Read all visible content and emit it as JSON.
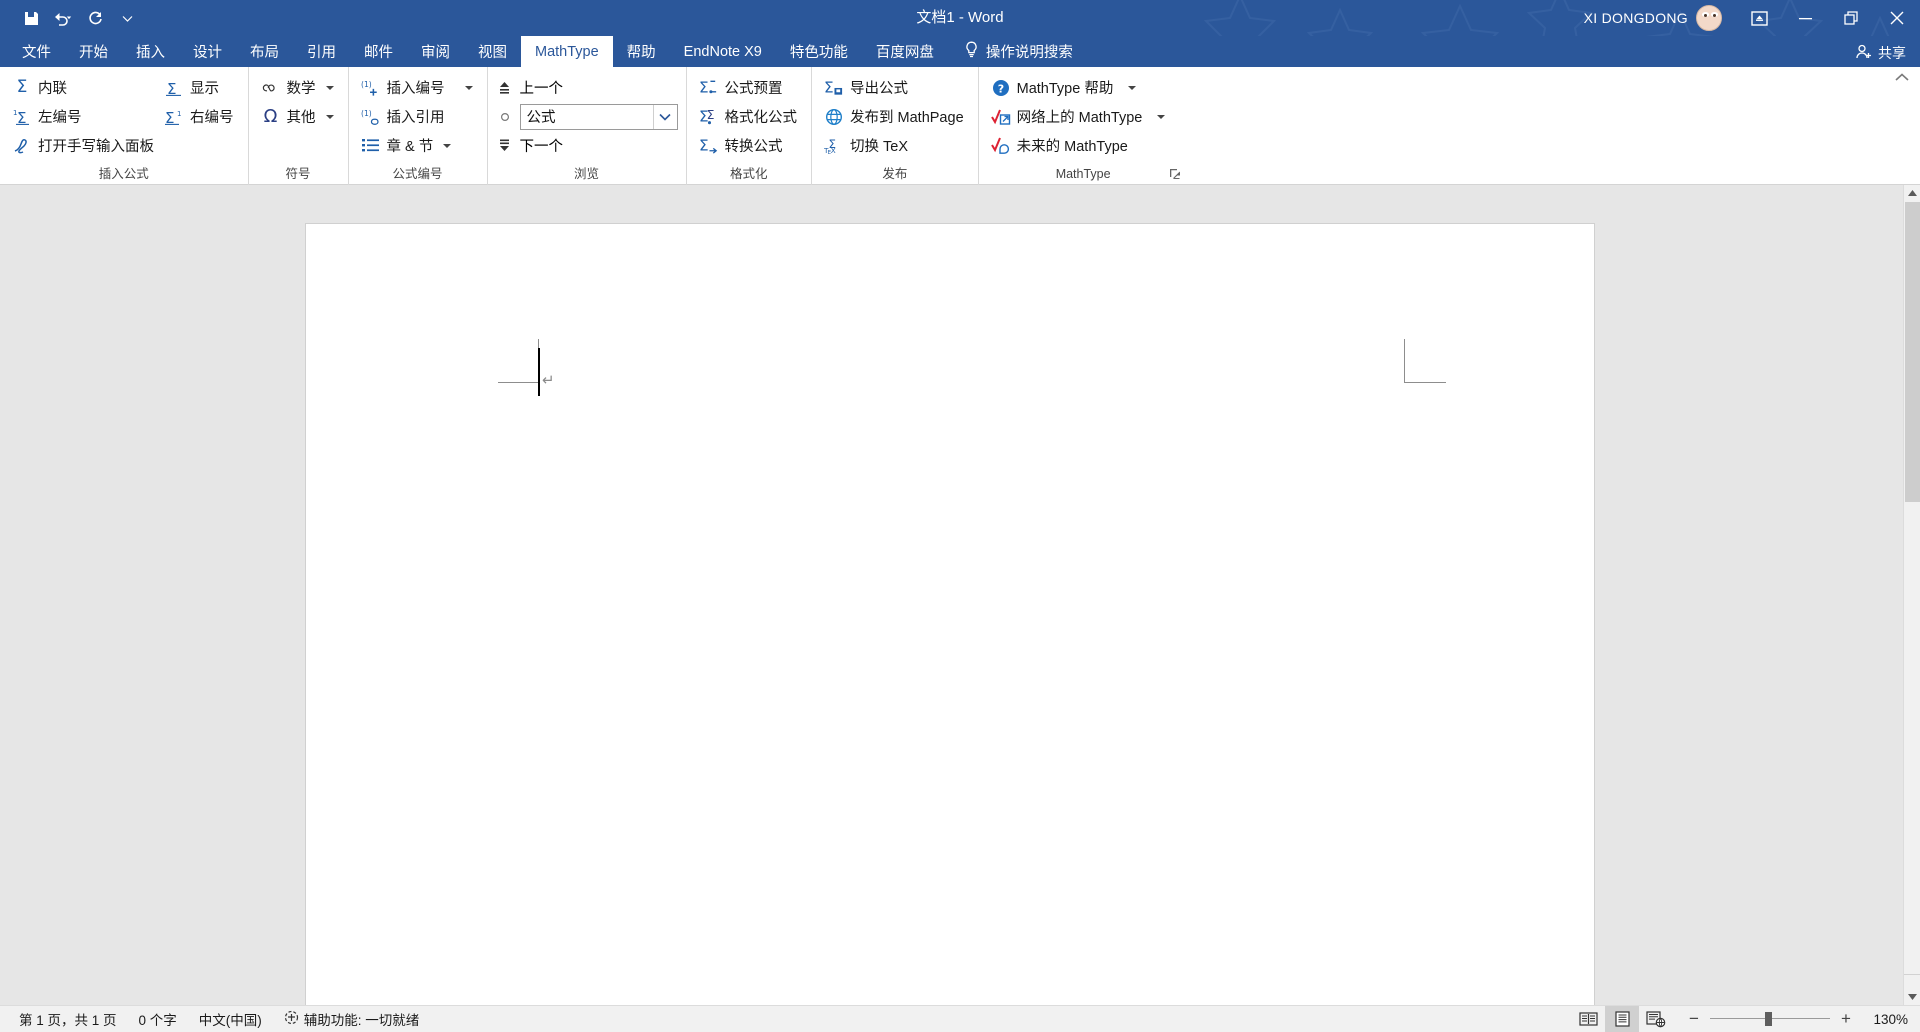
{
  "titlebar": {
    "document_title": "文档1  -  Word",
    "username": "XI DONGDONG",
    "quick_access": [
      {
        "name": "save-icon",
        "label": "保存"
      },
      {
        "name": "undo-icon",
        "label": "撤消"
      },
      {
        "name": "redo-icon",
        "label": "重复"
      },
      {
        "name": "customize-qat-icon",
        "label": "自定义快速访问工具栏"
      }
    ],
    "window_buttons": [
      {
        "name": "ribbon-display-options",
        "label": "功能区显示选项"
      },
      {
        "name": "minimize",
        "label": "最小化"
      },
      {
        "name": "restore",
        "label": "还原"
      },
      {
        "name": "close",
        "label": "关闭"
      }
    ]
  },
  "tabs": [
    {
      "label": "文件",
      "active": false
    },
    {
      "label": "开始",
      "active": false
    },
    {
      "label": "插入",
      "active": false
    },
    {
      "label": "设计",
      "active": false
    },
    {
      "label": "布局",
      "active": false
    },
    {
      "label": "引用",
      "active": false
    },
    {
      "label": "邮件",
      "active": false
    },
    {
      "label": "审阅",
      "active": false
    },
    {
      "label": "视图",
      "active": false
    },
    {
      "label": "MathType",
      "active": true
    },
    {
      "label": "帮助",
      "active": false
    },
    {
      "label": "EndNote X9",
      "active": false
    },
    {
      "label": "特色功能",
      "active": false
    },
    {
      "label": "百度网盘",
      "active": false
    }
  ],
  "tell_me": {
    "label": "操作说明搜索",
    "icon": "lightbulb-icon"
  },
  "share": {
    "label": "共享",
    "icon": "share-person-icon"
  },
  "ribbon": {
    "groups": [
      {
        "label": "插入公式",
        "columns": [
          {
            "items": [
              {
                "label": "内联",
                "icon": "sigma-inline-icon",
                "caret": false
              },
              {
                "label": "左编号",
                "icon": "sigma-left-number-icon",
                "caret": false
              },
              {
                "label": "打开手写输入面板",
                "icon": "handwriting-icon",
                "caret": false
              }
            ]
          },
          {
            "items": [
              {
                "label": "显示",
                "icon": "sigma-display-icon",
                "caret": false
              },
              {
                "label": "右编号",
                "icon": "sigma-right-number-icon",
                "caret": false
              }
            ]
          }
        ]
      },
      {
        "label": "符号",
        "columns": [
          {
            "items": [
              {
                "label": "数学",
                "icon": "infinity-icon",
                "caret": true
              },
              {
                "label": "其他",
                "icon": "omega-icon",
                "caret": true
              }
            ]
          }
        ]
      },
      {
        "label": "公式编号",
        "columns": [
          {
            "items": [
              {
                "label": "插入编号",
                "icon": "insert-number-icon",
                "caret": true
              },
              {
                "label": "插入引用",
                "icon": "insert-reference-icon",
                "caret": false
              },
              {
                "label": "章 & 节",
                "icon": "chapter-section-icon",
                "caret": true
              }
            ]
          }
        ]
      },
      {
        "label": "浏览",
        "columns": [
          {
            "items": [
              {
                "label": "上一个",
                "icon": "previous-icon",
                "caret": false
              },
              {
                "label": "",
                "icon": "browse-object-icon",
                "caret": false
              },
              {
                "label": "下一个",
                "icon": "next-icon",
                "caret": false
              }
            ]
          }
        ],
        "combo": {
          "value": "公式",
          "placeholder": "公式"
        }
      },
      {
        "label": "格式化",
        "columns": [
          {
            "items": [
              {
                "label": "公式预置",
                "icon": "equation-preferences-icon",
                "caret": false
              },
              {
                "label": "格式化公式",
                "icon": "format-equations-icon",
                "caret": false
              },
              {
                "label": "转换公式",
                "icon": "convert-equations-icon",
                "caret": false
              }
            ]
          }
        ]
      },
      {
        "label": "发布",
        "columns": [
          {
            "items": [
              {
                "label": "导出公式",
                "icon": "export-equations-icon",
                "caret": false
              },
              {
                "label": "发布到 MathPage",
                "icon": "globe-icon",
                "caret": false
              },
              {
                "label": "切换 TeX",
                "icon": "toggle-tex-icon",
                "caret": false
              }
            ]
          }
        ]
      },
      {
        "label": "MathType",
        "has_dialog_launcher": true,
        "columns": [
          {
            "items": [
              {
                "label": "MathType 帮助",
                "icon": "help-question-icon",
                "caret": true
              },
              {
                "label": "网络上的 MathType",
                "icon": "mathtype-web-icon",
                "caret": true
              },
              {
                "label": "未来的 MathType",
                "icon": "mathtype-future-icon",
                "caret": false
              }
            ]
          }
        ]
      }
    ],
    "collapse_icon": "chevron-up-icon"
  },
  "document": {
    "paragraph_mark": "↵",
    "margin_marks": [
      "top-left-margin-mark",
      "top-right-margin-mark"
    ]
  },
  "statusbar": {
    "page_info": "第 1 页，共 1 页",
    "word_count": "0 个字",
    "language": "中文(中国)",
    "accessibility": "辅助功能: 一切就绪",
    "views": [
      {
        "name": "read-mode-view",
        "label": "阅读视图",
        "active": false
      },
      {
        "name": "print-layout-view",
        "label": "页面视图",
        "active": true
      },
      {
        "name": "web-layout-view",
        "label": "Web 版式视图",
        "active": false
      }
    ],
    "zoom": {
      "minus": "−",
      "plus": "+",
      "value": "130%"
    }
  },
  "colors": {
    "word_blue": "#2b579a",
    "ribbon_bg": "#ffffff",
    "icon_blue": "#1f5fa9",
    "page_bg": "#e6e6e6"
  }
}
